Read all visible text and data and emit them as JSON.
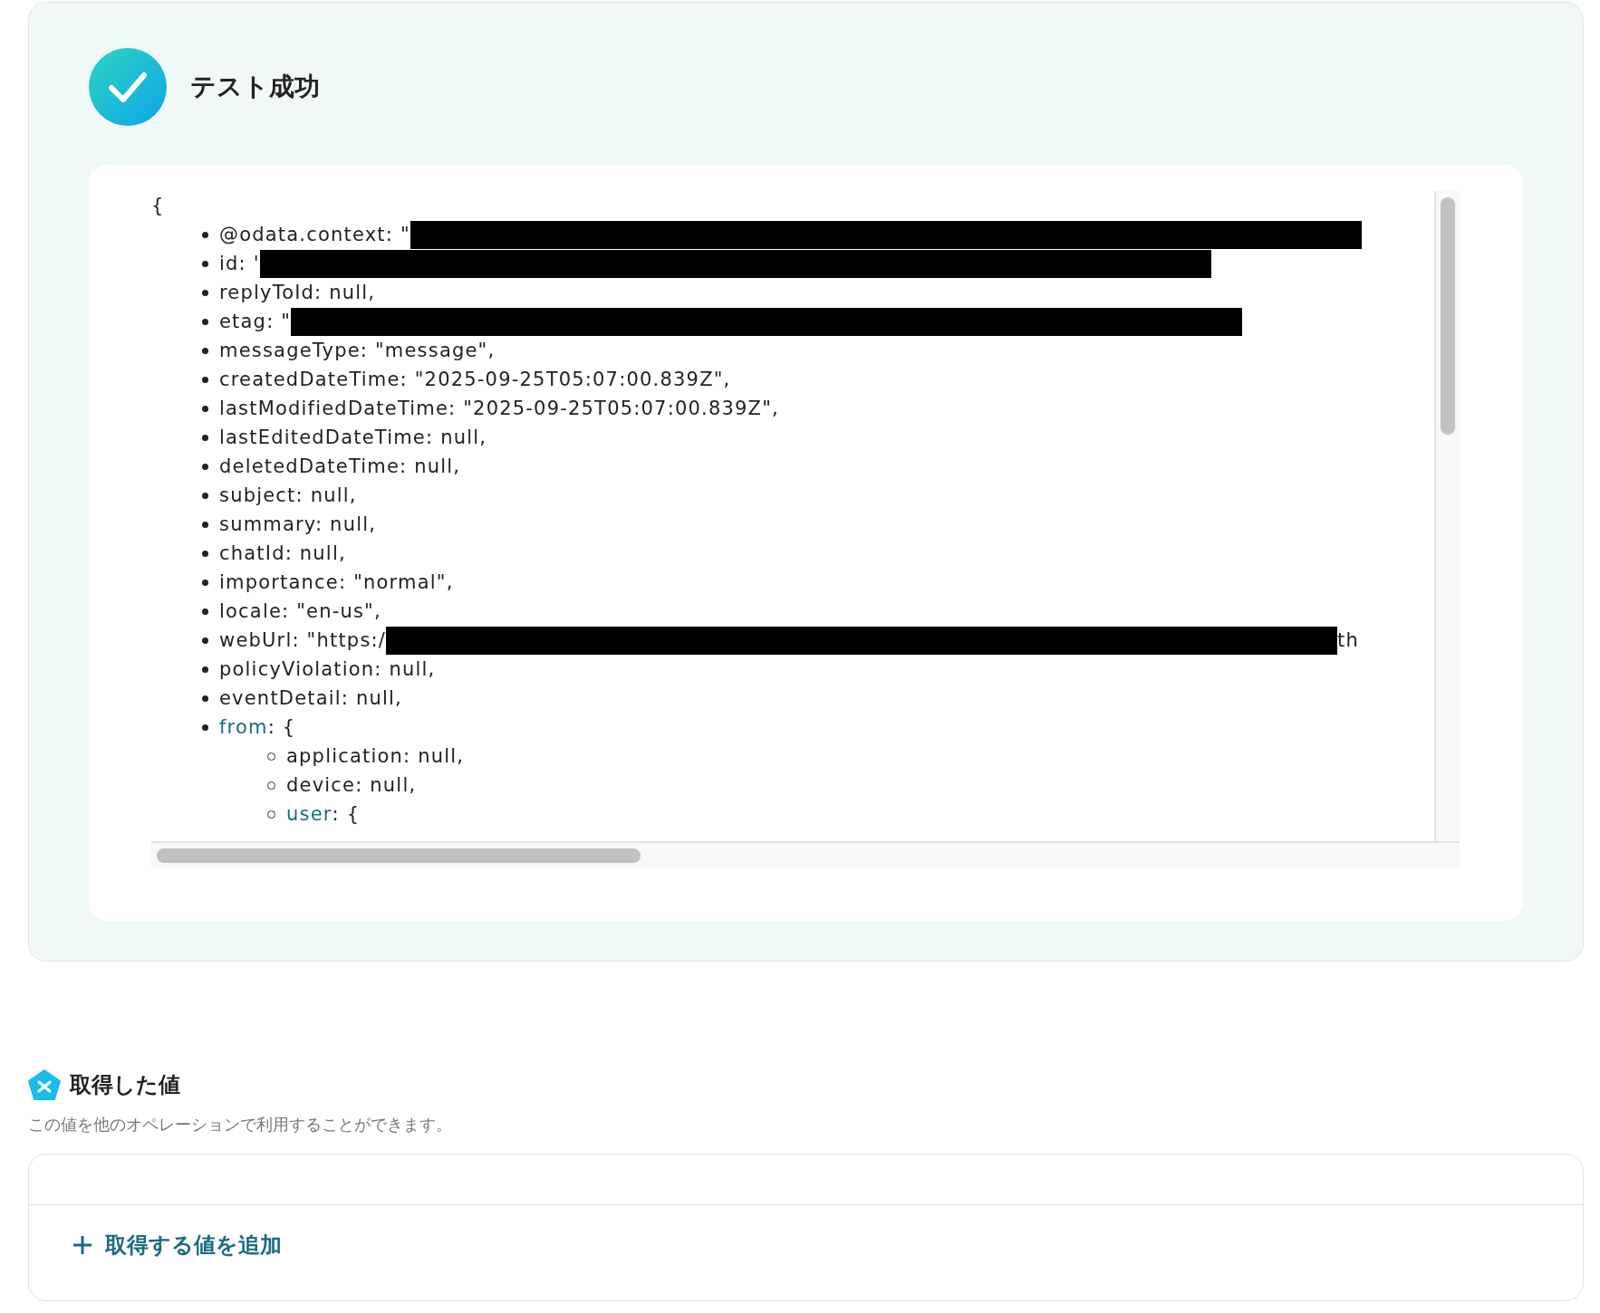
{
  "result": {
    "title": "テスト成功",
    "passed": true,
    "code_view": {
      "open": "{",
      "lines": [
        {
          "kind": "redacted",
          "text": "@odata.context: \""
        },
        {
          "kind": "redacted",
          "text": "id: '"
        },
        {
          "kind": "field",
          "text": "replyToId: null,"
        },
        {
          "kind": "redacted",
          "text": "etag: \""
        },
        {
          "kind": "field",
          "text": "messageType: \"message\","
        },
        {
          "kind": "field",
          "text": "createdDateTime: \"2025-09-25T05:07:00.839Z\","
        },
        {
          "kind": "field",
          "text": "lastModifiedDateTime: \"2025-09-25T05:07:00.839Z\","
        },
        {
          "kind": "field",
          "text": "lastEditedDateTime: null,"
        },
        {
          "kind": "field",
          "text": "deletedDateTime: null,"
        },
        {
          "kind": "field",
          "text": "subject: null,"
        },
        {
          "kind": "field",
          "text": "summary: null,"
        },
        {
          "kind": "field",
          "text": "chatId: null,"
        },
        {
          "kind": "field",
          "text": "importance: \"normal\","
        },
        {
          "kind": "field",
          "text": "locale: \"en-us\","
        },
        {
          "kind": "redacted",
          "text": "webUrl: \"https:/",
          "tail": "th"
        },
        {
          "kind": "field",
          "text": "policyViolation: null,"
        },
        {
          "kind": "field",
          "text": "eventDetail: null,"
        },
        {
          "kind": "object",
          "key": "from",
          "rest": ": {",
          "children": [
            {
              "kind": "field",
              "text": "application: null,"
            },
            {
              "kind": "field",
              "text": "device: null,"
            },
            {
              "kind": "object",
              "key": "user",
              "rest": ": {"
            }
          ]
        }
      ]
    }
  },
  "values_section": {
    "title": "取得した値",
    "description": "この値を他のオペレーションで利用することができます。",
    "add_button": "取得する値を追加"
  }
}
